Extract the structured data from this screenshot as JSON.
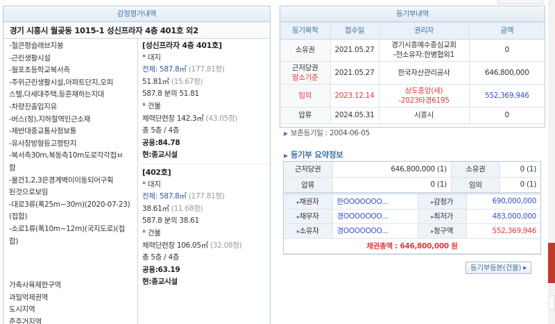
{
  "appraisal": {
    "header": "감정평가내역",
    "address": "경기 시흥시 월곶동 1015-1 성신프라자 4층 401호 외2",
    "features": [
      "-철콘평슬래브지붕",
      "-근린생활시설",
      "-월포초등학교북서측",
      "-주위근린생활시설,아파트단지,오피",
      "스텔,다세대주택,등혼재하는지대",
      "-차량진출입지유",
      "-버스(정),지하철역인근소재",
      "-제반대중교통사정보통",
      "-유사장방형등고평탄지",
      "-북서측30m,북동측10m도로각각접ㅂ",
      "함",
      "-물건1,2,3은경계벽이이동되어구획",
      "된것으로보임",
      "-대로3류(폭25m~30m)(2020-07-23)",
      "(접합)",
      "-소로1류(폭10m~12m)(국지도로)(접",
      "합)"
    ],
    "zones": [
      "가축사육제한구역",
      "과밀억제권역",
      "도시지역",
      "준주거지역"
    ],
    "units": [
      {
        "title": "[성신프라자 4층 401호]",
        "land_label": "* 대지",
        "total_land": "전체: 587.8㎡",
        "total_land_py": "(177.81평)",
        "share_area": "51.81㎡",
        "share_area_py": "(15.67평)",
        "share_ratio": "587.8 분의 51.81",
        "bldg_label": "* 건물",
        "bldg_area": "체력단련장 142.3㎡",
        "bldg_area_py": "(43.05평)",
        "floors": "총 5층 / 4층",
        "common": "공용:84.78",
        "current": "현:종교시설"
      },
      {
        "title": "[402호]",
        "land_label": "* 대지",
        "total_land": "전체: 587.8㎡",
        "total_land_py": "(177.81평)",
        "share_area": "38.61㎡",
        "share_area_py": "(11.68평)",
        "share_ratio": "587.8 분의 38.61",
        "bldg_label": "* 건물",
        "bldg_area": "체력단련장 106.05㎡",
        "bldg_area_py": "(32.08평)",
        "floors": "총 5층 / 4층",
        "common": "공용:63.19",
        "current": "현:종교시설"
      }
    ]
  },
  "registry": {
    "header": "등기부내역",
    "columns": [
      "등기목적",
      "접수일",
      "권리자",
      "금액"
    ],
    "rows": [
      {
        "purpose": "소유권",
        "date": "2021.05.27",
        "holder_1": "경기시흥예수중심교회",
        "holder_2": "-전소유자:한병협외1",
        "amount": "0"
      },
      {
        "purpose": "근저당권",
        "purpose_note": "말소기준",
        "date": "2021.05.27",
        "holder_1": "한국자산관리공사",
        "amount": "646,800,000"
      },
      {
        "purpose": "임의",
        "date": "2023.12.14",
        "holder_1": "상도중앙(새)",
        "holder_2": "-2023타경6195",
        "amount": "552,369,946"
      },
      {
        "purpose": "압류",
        "date": "2024.05.31",
        "holder_1": "시흥시",
        "amount": "0"
      }
    ],
    "preservation": "보존등기일 : 2004-06-05"
  },
  "summary": {
    "title": "등기부 요약정보",
    "rows": [
      {
        "left_label": "근저당권",
        "left_value": "646,800,000  (1)",
        "right_label": "소유권",
        "right_value": "0  (1)"
      },
      {
        "left_label": "압류",
        "left_value": "0  (1)",
        "right_label": "임의",
        "right_value": "0  (1)"
      }
    ],
    "parties": [
      {
        "label": "채권자",
        "name": "한OOOOOOO...",
        "right_label": "감정가",
        "right_value": "690,000,000"
      },
      {
        "label": "채무자",
        "name": "경OOOOOOO...",
        "right_label": "최저가",
        "right_value": "483,000,000"
      },
      {
        "label": "소유자",
        "name": "경OOOOOOO...",
        "right_label": "청구액",
        "right_value": "552,369,946"
      }
    ],
    "total": "채권총액 : 646,800,000 원",
    "detail_button": "등기부등본(건물)"
  }
}
